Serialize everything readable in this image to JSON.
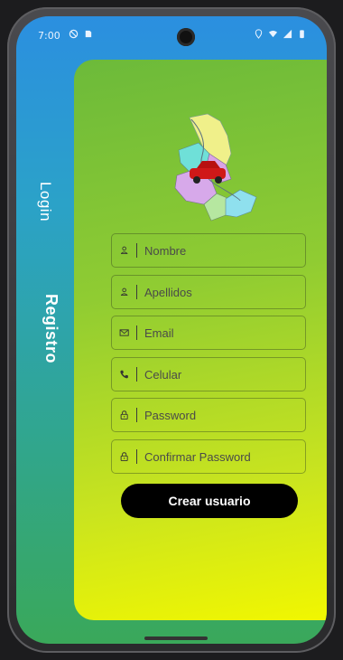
{
  "status_bar": {
    "time": "7:00"
  },
  "side_tabs": {
    "login": "Login",
    "registro": "Registro"
  },
  "form": {
    "fields": [
      {
        "placeholder": "Nombre",
        "icon": "person-icon"
      },
      {
        "placeholder": "Apellidos",
        "icon": "person-icon"
      },
      {
        "placeholder": "Email",
        "icon": "mail-icon"
      },
      {
        "placeholder": "Celular",
        "icon": "phone-icon"
      },
      {
        "placeholder": "Password",
        "icon": "lock-icon"
      },
      {
        "placeholder": "Confirmar Password",
        "icon": "lock-icon"
      }
    ],
    "submit_label": "Crear usuario"
  },
  "colors": {
    "card_top": "#6cba3a",
    "card_bottom": "#f2f700",
    "screen_top": "#2b8fe0",
    "button": "#000000"
  }
}
